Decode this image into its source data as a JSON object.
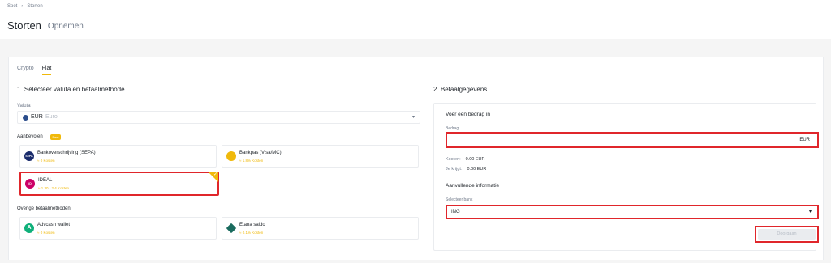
{
  "breadcrumb": {
    "parent": "Spot",
    "current": "Storten"
  },
  "top_tabs": {
    "deposit": "Storten",
    "withdraw": "Opnemen"
  },
  "sub_tabs": {
    "crypto": "Crypto",
    "fiat": "Fiat"
  },
  "left": {
    "title": "1. Selecteer valuta en betaalmethode",
    "currency_label": "Valuta",
    "currency_code": "EUR",
    "currency_name": "Euro",
    "recommended_label": "Aanbevolen",
    "recommended_badge": "Best",
    "recommended": [
      {
        "name": "Bankoverschrijving (SEPA)",
        "fee": "≈ 0 Kosten",
        "icon": "sepa-icon",
        "icon_text": "SEPA",
        "icon_color": "#1a2b6b"
      },
      {
        "name": "Bankpas (Visa/MC)",
        "fee": "≈ 1.8% Kosten",
        "icon": "card-icon",
        "icon_text": "",
        "icon_color": "#f0b90b"
      },
      {
        "name": "IDEAL",
        "fee": "≈ 1.30 - 2.4 Kosten",
        "icon": "ideal-icon",
        "icon_text": "iD",
        "icon_color": "#cc0066"
      }
    ],
    "other_label": "Overige betaalmethoden",
    "others": [
      {
        "name": "Advcash wallet",
        "fee": "≈ 0 Kosten",
        "icon": "advcash-icon",
        "icon_text": "A",
        "icon_color": "#0fb07a"
      },
      {
        "name": "Etana saldo",
        "fee": "≈ 0.1% Kosten",
        "icon": "etana-icon",
        "icon_text": "",
        "icon_color": "#1a6b5e"
      }
    ]
  },
  "right": {
    "title": "2. Betaalgegevens",
    "amount_heading": "Voer een bedrag in",
    "amount_label": "Bedrag",
    "amount_currency": "EUR",
    "fee_label": "Kosten:",
    "fee_value": "0.00 EUR",
    "receive_label": "Je krijgt:",
    "receive_value": "0.00 EUR",
    "extra_heading": "Aanvullende informatie",
    "bank_label": "Selecteer bank",
    "bank_value": "ING",
    "continue_button": "Doorgaan"
  },
  "colors": {
    "accent": "#f0b90b",
    "highlight": "#e0262b"
  }
}
